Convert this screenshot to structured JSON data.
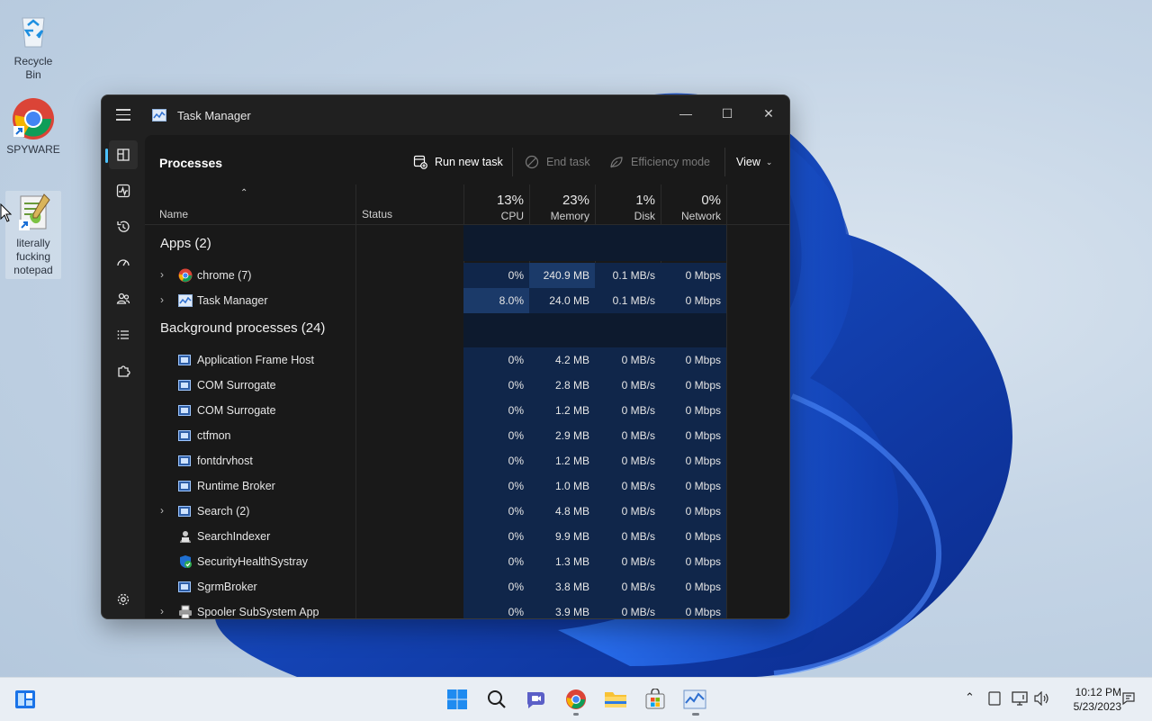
{
  "desktop": {
    "icons": [
      {
        "label": "Recycle Bin",
        "icon": "recycle-bin-icon"
      },
      {
        "label": "SPYWARE",
        "icon": "chrome-icon"
      },
      {
        "label": "literally fucking notepad",
        "icon": "notepad-icon"
      }
    ]
  },
  "window": {
    "title": "Task Manager",
    "controls": {
      "minimize": "—",
      "maximize": "☐",
      "close": "✕"
    }
  },
  "toolbar": {
    "page_title": "Processes",
    "run_new_task": "Run new task",
    "end_task": "End task",
    "efficiency_mode": "Efficiency mode",
    "view": "View"
  },
  "columns": {
    "name": "Name",
    "status": "Status",
    "cpu": {
      "pct": "13%",
      "label": "CPU"
    },
    "memory": {
      "pct": "23%",
      "label": "Memory"
    },
    "disk": {
      "pct": "1%",
      "label": "Disk"
    },
    "network": {
      "pct": "0%",
      "label": "Network"
    }
  },
  "groups": {
    "apps": "Apps (2)",
    "background": "Background processes (24)"
  },
  "apps": [
    {
      "name": "chrome (7)",
      "cpu": "0%",
      "memory": "240.9 MB",
      "disk": "0.1 MB/s",
      "network": "0 Mbps",
      "icon": "chrome-icon"
    },
    {
      "name": "Task Manager",
      "cpu": "8.0%",
      "memory": "24.0 MB",
      "disk": "0.1 MB/s",
      "network": "0 Mbps",
      "icon": "task-manager-icon"
    }
  ],
  "background": [
    {
      "name": "Application Frame Host",
      "cpu": "0%",
      "memory": "4.2 MB",
      "disk": "0 MB/s",
      "network": "0 Mbps"
    },
    {
      "name": "COM Surrogate",
      "cpu": "0%",
      "memory": "2.8 MB",
      "disk": "0 MB/s",
      "network": "0 Mbps"
    },
    {
      "name": "COM Surrogate",
      "cpu": "0%",
      "memory": "1.2 MB",
      "disk": "0 MB/s",
      "network": "0 Mbps"
    },
    {
      "name": "ctfmon",
      "cpu": "0%",
      "memory": "2.9 MB",
      "disk": "0 MB/s",
      "network": "0 Mbps"
    },
    {
      "name": "fontdrvhost",
      "cpu": "0%",
      "memory": "1.2 MB",
      "disk": "0 MB/s",
      "network": "0 Mbps"
    },
    {
      "name": "Runtime Broker",
      "cpu": "0%",
      "memory": "1.0 MB",
      "disk": "0 MB/s",
      "network": "0 Mbps"
    },
    {
      "name": "Search (2)",
      "cpu": "0%",
      "memory": "4.8 MB",
      "disk": "0 MB/s",
      "network": "0 Mbps"
    },
    {
      "name": "SearchIndexer",
      "cpu": "0%",
      "memory": "9.9 MB",
      "disk": "0 MB/s",
      "network": "0 Mbps"
    },
    {
      "name": "SecurityHealthSystray",
      "cpu": "0%",
      "memory": "1.3 MB",
      "disk": "0 MB/s",
      "network": "0 Mbps"
    },
    {
      "name": "SgrmBroker",
      "cpu": "0%",
      "memory": "3.8 MB",
      "disk": "0 MB/s",
      "network": "0 Mbps"
    },
    {
      "name": "Spooler SubSystem App",
      "cpu": "0%",
      "memory": "3.9 MB",
      "disk": "0 MB/s",
      "network": "0 Mbps"
    }
  ],
  "taskbar": {
    "time": "10:12 PM",
    "date": "5/23/2023"
  },
  "colors": {
    "accent": "#4cc2ff",
    "highlight_dark": "#10264a",
    "highlight_mid": "#1b3a69"
  }
}
